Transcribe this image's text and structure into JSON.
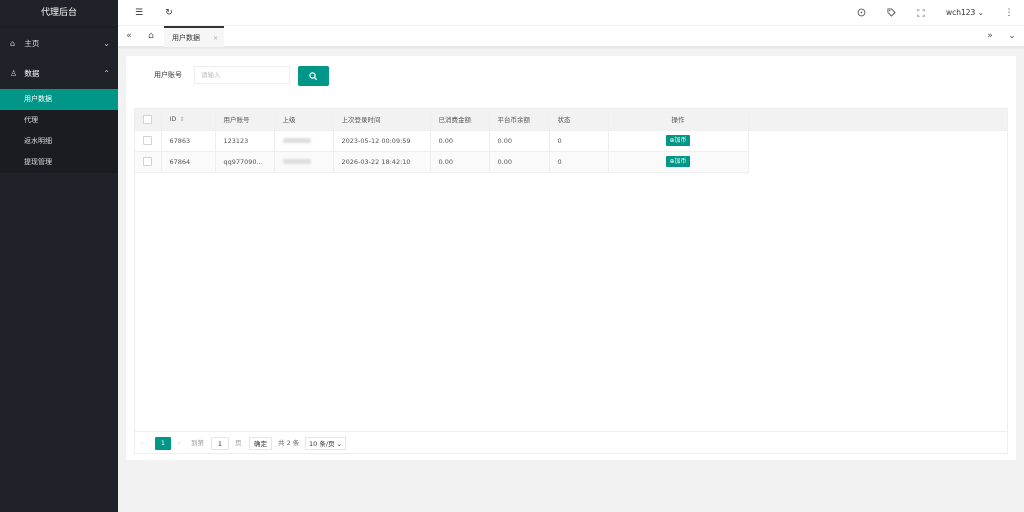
{
  "app": {
    "title": "代理后台"
  },
  "sidebar": {
    "items": [
      {
        "label": "主页",
        "icon": "home-icon"
      },
      {
        "label": "数据",
        "icon": "user-icon"
      }
    ],
    "subitems": [
      {
        "label": "用户数据",
        "active": true
      },
      {
        "label": "代理"
      },
      {
        "label": "返水明细"
      },
      {
        "label": "提现管理"
      }
    ]
  },
  "header": {
    "menu_icon": "☰",
    "refresh_icon": "↻",
    "username": "wch123",
    "icons": [
      "theme-icon",
      "tag-icon",
      "fullscreen-icon",
      "more-icon"
    ]
  },
  "tabs": [
    {
      "label": "用户数据",
      "close": "×"
    }
  ],
  "search": {
    "label": "用户账号",
    "placeholder": "请输入"
  },
  "table": {
    "columns": [
      "ID",
      "用户账号",
      "上级",
      "上次登录时间",
      "已消费金额",
      "平台币余额",
      "状态",
      "操作"
    ],
    "rows": [
      {
        "id": "67863",
        "account": "123123",
        "last_login": "2023-05-12 00:09:59",
        "spent": "0.00",
        "balance": "0.00",
        "status": "0",
        "action": "⊕加币"
      },
      {
        "id": "67864",
        "account": "qq977090...",
        "last_login": "2026-03-22 18:42:10",
        "spent": "0.00",
        "balance": "0.00",
        "status": "0",
        "action": "⊕加币"
      }
    ]
  },
  "pager": {
    "current": "1",
    "goto_label": "到第",
    "page_input": "1",
    "page_unit": "页",
    "confirm": "确定",
    "total": "共 2 条",
    "page_size": "10 条/页"
  },
  "colors": {
    "accent": "#009688",
    "sidebar_bg": "#20222a"
  }
}
